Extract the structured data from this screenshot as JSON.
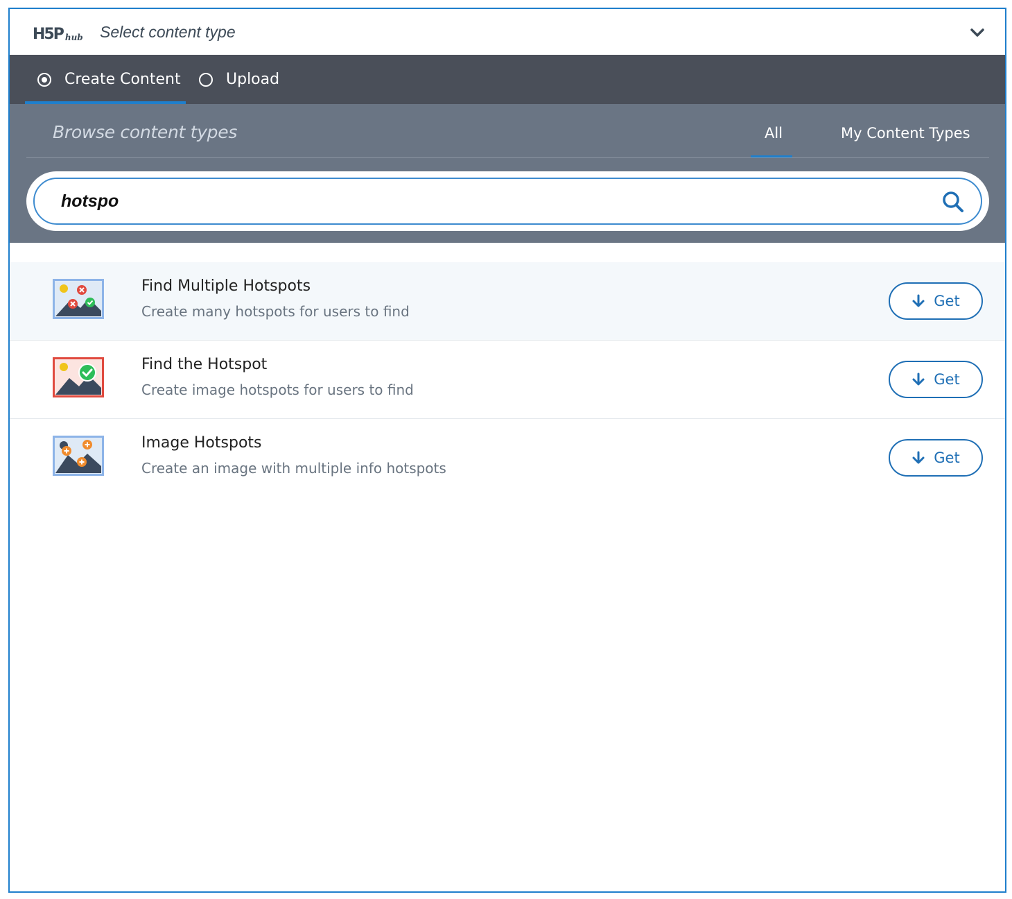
{
  "header": {
    "logo_main": "H5P",
    "logo_sub": "hub",
    "title": "Select content type",
    "collapse_icon": "chevron-down-icon"
  },
  "tabs": [
    {
      "label": "Create Content",
      "selected": true
    },
    {
      "label": "Upload",
      "selected": false
    }
  ],
  "browse": {
    "title": "Browse content types",
    "filters": [
      {
        "label": "All",
        "active": true
      },
      {
        "label": "My Content Types",
        "active": false
      }
    ],
    "search_value": "hotspo",
    "search_icon": "search-icon"
  },
  "results": [
    {
      "title": "Find Multiple Hotspots",
      "description": "Create many hotspots for users to find",
      "action": "Get",
      "icon": "find-multiple-hotspots-icon"
    },
    {
      "title": "Find the Hotspot",
      "description": "Create image hotspots for users to find",
      "action": "Get",
      "icon": "find-the-hotspot-icon"
    },
    {
      "title": "Image Hotspots",
      "description": "Create an image with multiple info hotspots",
      "action": "Get",
      "icon": "image-hotspots-icon"
    }
  ],
  "colors": {
    "accent": "#1f7fcc",
    "tabbar": "#4a4f59",
    "browse_panel": "#6a7584",
    "button": "#1f6fb5"
  }
}
